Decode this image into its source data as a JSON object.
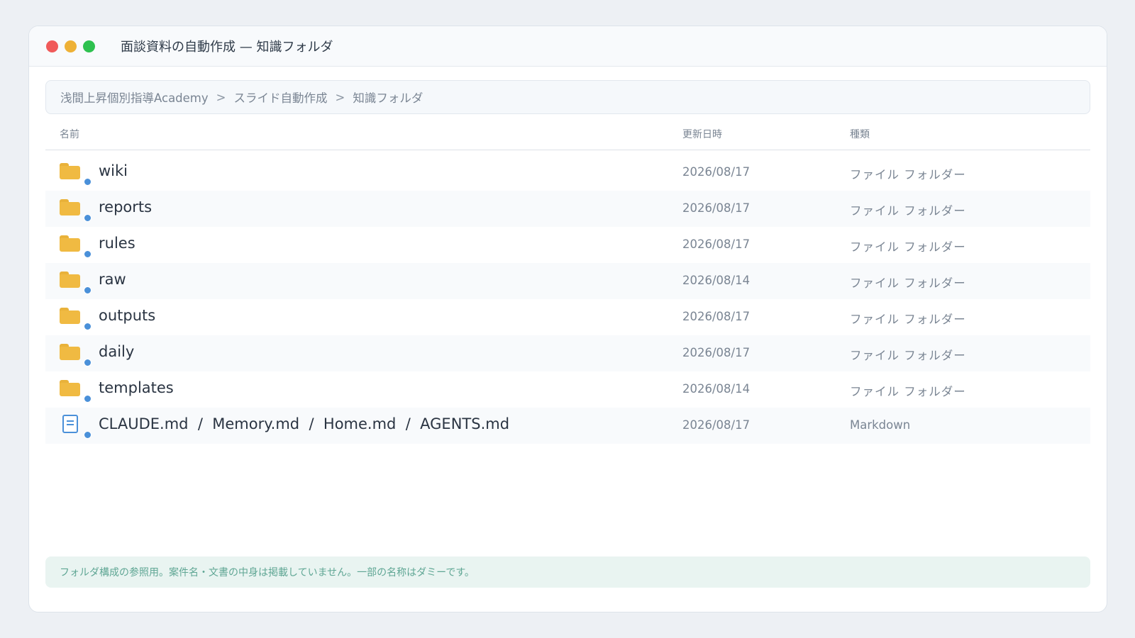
{
  "window": {
    "title": "面談資料の自動作成 — 知識フォルダ"
  },
  "breadcrumb": {
    "items": [
      "浅間上昇個別指導Academy",
      "スライド自動作成",
      "知識フォルダ"
    ],
    "separator": ">"
  },
  "columns": {
    "name": "名前",
    "date": "更新日時",
    "kind": "種類"
  },
  "rows": [
    {
      "name": "wiki",
      "date": "2026/08/17",
      "kind": "ファイル フォルダー",
      "icon": "folder-icon"
    },
    {
      "name": "reports",
      "date": "2026/08/17",
      "kind": "ファイル フォルダー",
      "icon": "folder-icon"
    },
    {
      "name": "rules",
      "date": "2026/08/17",
      "kind": "ファイル フォルダー",
      "icon": "folder-icon"
    },
    {
      "name": "raw",
      "date": "2026/08/14",
      "kind": "ファイル フォルダー",
      "icon": "folder-icon"
    },
    {
      "name": "outputs",
      "date": "2026/08/17",
      "kind": "ファイル フォルダー",
      "icon": "folder-icon"
    },
    {
      "name": "daily",
      "date": "2026/08/17",
      "kind": "ファイル フォルダー",
      "icon": "folder-icon"
    },
    {
      "name": "templates",
      "date": "2026/08/14",
      "kind": "ファイル フォルダー",
      "icon": "folder-icon"
    },
    {
      "name": "CLAUDE.md  /  Memory.md  /  Home.md  /  AGENTS.md",
      "date": "2026/08/17",
      "kind": "Markdown",
      "icon": "document-icon"
    }
  ],
  "footnote": "フォルダ構成の参照用。案件名・文書の中身は掲載していません。一部の名称はダミーです。",
  "colors": {
    "folder": "#f0ba42",
    "sync_dot": "#4a90d9",
    "close": "#f05a5a",
    "minimize": "#eeb136",
    "maximize": "#2ec14f",
    "footnote_bg": "#e9f4f1",
    "footnote_text": "#5fa694"
  }
}
